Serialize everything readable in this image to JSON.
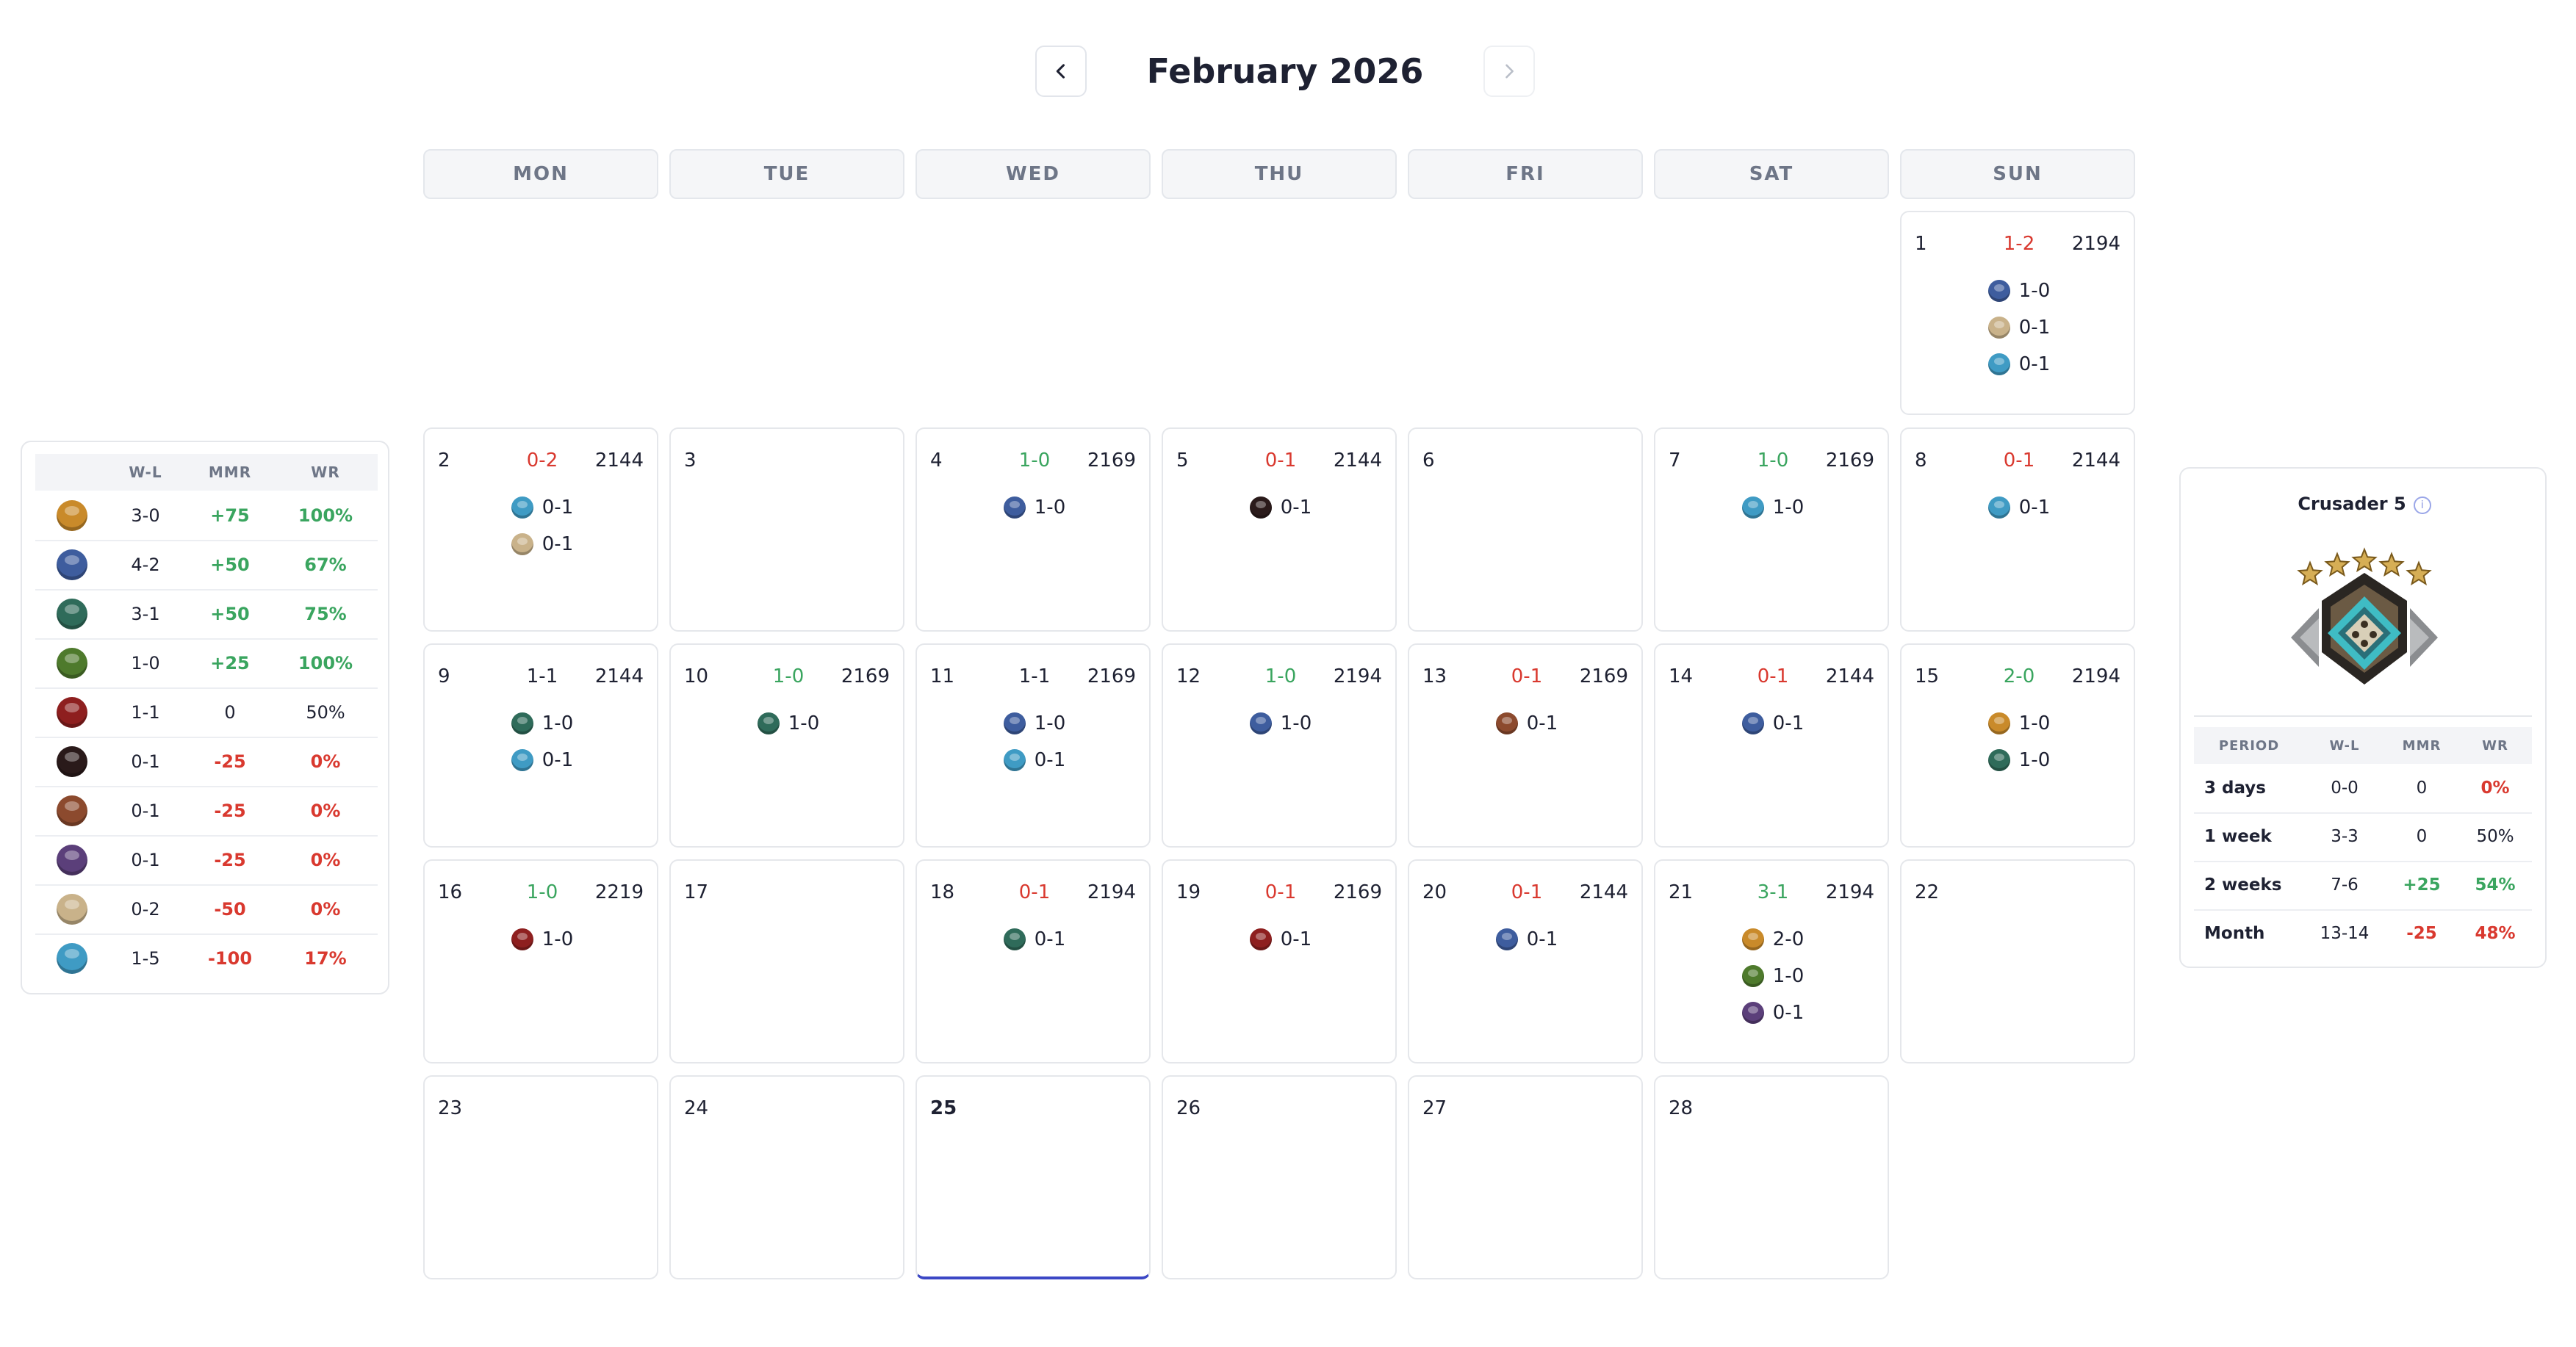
{
  "header": {
    "title": "February 2026",
    "prev_icon": "chevron-left-icon",
    "next_icon": "chevron-right-icon"
  },
  "weekdays": [
    "MON",
    "TUE",
    "WED",
    "THU",
    "FRI",
    "SAT",
    "SUN"
  ],
  "colors": {
    "positive": "#3aa55f",
    "negative": "#d9392f",
    "today_accent": "#3b47c5"
  },
  "days": [
    {
      "day": "1",
      "wl": "1-2",
      "mmr": "2194",
      "tone": "neg",
      "heroes": [
        {
          "icon": "hero-blue-mage",
          "wl": "1-0"
        },
        {
          "icon": "hero-bone-knight",
          "wl": "0-1"
        },
        {
          "icon": "hero-ice-spirit",
          "wl": "0-1"
        }
      ]
    },
    {
      "day": "2",
      "wl": "0-2",
      "mmr": "2144",
      "tone": "neg",
      "heroes": [
        {
          "icon": "hero-ice-spirit",
          "wl": "0-1"
        },
        {
          "icon": "hero-bone-knight",
          "wl": "0-1"
        }
      ]
    },
    {
      "day": "3",
      "wl": "",
      "mmr": "",
      "tone": "neu",
      "heroes": []
    },
    {
      "day": "4",
      "wl": "1-0",
      "mmr": "2169",
      "tone": "pos",
      "heroes": [
        {
          "icon": "hero-blue-mage",
          "wl": "1-0"
        }
      ]
    },
    {
      "day": "5",
      "wl": "0-1",
      "mmr": "2144",
      "tone": "neg",
      "heroes": [
        {
          "icon": "hero-shadow-demon",
          "wl": "0-1"
        }
      ]
    },
    {
      "day": "6",
      "wl": "",
      "mmr": "",
      "tone": "neu",
      "heroes": []
    },
    {
      "day": "7",
      "wl": "1-0",
      "mmr": "2169",
      "tone": "pos",
      "heroes": [
        {
          "icon": "hero-ice-spirit",
          "wl": "1-0"
        }
      ]
    },
    {
      "day": "8",
      "wl": "0-1",
      "mmr": "2144",
      "tone": "neg",
      "heroes": [
        {
          "icon": "hero-ice-spirit",
          "wl": "0-1"
        }
      ]
    },
    {
      "day": "9",
      "wl": "1-1",
      "mmr": "2144",
      "tone": "neu",
      "heroes": [
        {
          "icon": "hero-green-undead",
          "wl": "1-0"
        },
        {
          "icon": "hero-ice-spirit",
          "wl": "0-1"
        }
      ]
    },
    {
      "day": "10",
      "wl": "1-0",
      "mmr": "2169",
      "tone": "pos",
      "heroes": [
        {
          "icon": "hero-green-undead",
          "wl": "1-0"
        }
      ]
    },
    {
      "day": "11",
      "wl": "1-1",
      "mmr": "2169",
      "tone": "neu",
      "heroes": [
        {
          "icon": "hero-blue-mage",
          "wl": "1-0"
        },
        {
          "icon": "hero-ice-spirit",
          "wl": "0-1"
        }
      ]
    },
    {
      "day": "12",
      "wl": "1-0",
      "mmr": "2194",
      "tone": "pos",
      "heroes": [
        {
          "icon": "hero-blue-mage",
          "wl": "1-0"
        }
      ]
    },
    {
      "day": "13",
      "wl": "0-1",
      "mmr": "2169",
      "tone": "neg",
      "heroes": [
        {
          "icon": "hero-red-hair",
          "wl": "0-1"
        }
      ]
    },
    {
      "day": "14",
      "wl": "0-1",
      "mmr": "2144",
      "tone": "neg",
      "heroes": [
        {
          "icon": "hero-blue-mage",
          "wl": "0-1"
        }
      ]
    },
    {
      "day": "15",
      "wl": "2-0",
      "mmr": "2194",
      "tone": "pos",
      "heroes": [
        {
          "icon": "hero-golden-king",
          "wl": "1-0"
        },
        {
          "icon": "hero-green-undead",
          "wl": "1-0"
        }
      ]
    },
    {
      "day": "16",
      "wl": "1-0",
      "mmr": "2219",
      "tone": "pos",
      "heroes": [
        {
          "icon": "hero-red-beast",
          "wl": "1-0"
        }
      ]
    },
    {
      "day": "17",
      "wl": "",
      "mmr": "",
      "tone": "neu",
      "heroes": []
    },
    {
      "day": "18",
      "wl": "0-1",
      "mmr": "2194",
      "tone": "neg",
      "heroes": [
        {
          "icon": "hero-green-undead",
          "wl": "0-1"
        }
      ]
    },
    {
      "day": "19",
      "wl": "0-1",
      "mmr": "2169",
      "tone": "neg",
      "heroes": [
        {
          "icon": "hero-red-beast",
          "wl": "0-1"
        }
      ]
    },
    {
      "day": "20",
      "wl": "0-1",
      "mmr": "2144",
      "tone": "neg",
      "heroes": [
        {
          "icon": "hero-blue-mage",
          "wl": "0-1"
        }
      ]
    },
    {
      "day": "21",
      "wl": "3-1",
      "mmr": "2194",
      "tone": "pos",
      "heroes": [
        {
          "icon": "hero-golden-king",
          "wl": "2-0"
        },
        {
          "icon": "hero-orc-warrior",
          "wl": "1-0"
        },
        {
          "icon": "hero-purple-beast",
          "wl": "0-1"
        }
      ]
    },
    {
      "day": "22",
      "wl": "",
      "mmr": "",
      "tone": "neu",
      "heroes": []
    },
    {
      "day": "23",
      "wl": "",
      "mmr": "",
      "tone": "neu",
      "heroes": []
    },
    {
      "day": "24",
      "wl": "",
      "mmr": "",
      "tone": "neu",
      "heroes": []
    },
    {
      "day": "25",
      "wl": "",
      "mmr": "",
      "tone": "neu",
      "heroes": [],
      "today": true
    },
    {
      "day": "26",
      "wl": "",
      "mmr": "",
      "tone": "neu",
      "heroes": []
    },
    {
      "day": "27",
      "wl": "",
      "mmr": "",
      "tone": "neu",
      "heroes": []
    },
    {
      "day": "28",
      "wl": "",
      "mmr": "",
      "tone": "neu",
      "heroes": []
    }
  ],
  "hero_colors": {
    "hero-blue-mage": "#3e5d9e",
    "hero-bone-knight": "#c9b28a",
    "hero-ice-spirit": "#3f9bc4",
    "hero-shadow-demon": "#2a1a1a",
    "hero-green-undead": "#2f6b5a",
    "hero-red-hair": "#8c4a2e",
    "hero-golden-king": "#c98a2a",
    "hero-red-beast": "#8e1f1f",
    "hero-orc-warrior": "#4e7a2c",
    "hero-purple-beast": "#5b3f7a"
  },
  "hero_stats": {
    "headers": [
      "",
      "W-L",
      "MMR",
      "WR"
    ],
    "rows": [
      {
        "icon": "hero-golden-king",
        "wl": "3-0",
        "mmr": "+75",
        "wr": "100%",
        "tone": "pos"
      },
      {
        "icon": "hero-blue-mage",
        "wl": "4-2",
        "mmr": "+50",
        "wr": "67%",
        "tone": "pos"
      },
      {
        "icon": "hero-green-undead",
        "wl": "3-1",
        "mmr": "+50",
        "wr": "75%",
        "tone": "pos"
      },
      {
        "icon": "hero-orc-warrior",
        "wl": "1-0",
        "mmr": "+25",
        "wr": "100%",
        "tone": "pos"
      },
      {
        "icon": "hero-red-beast",
        "wl": "1-1",
        "mmr": "0",
        "wr": "50%",
        "tone": "neu"
      },
      {
        "icon": "hero-shadow-demon",
        "wl": "0-1",
        "mmr": "-25",
        "wr": "0%",
        "tone": "neg"
      },
      {
        "icon": "hero-red-hair",
        "wl": "0-1",
        "mmr": "-25",
        "wr": "0%",
        "tone": "neg"
      },
      {
        "icon": "hero-purple-beast",
        "wl": "0-1",
        "mmr": "-25",
        "wr": "0%",
        "tone": "neg"
      },
      {
        "icon": "hero-bone-knight",
        "wl": "0-2",
        "mmr": "-50",
        "wr": "0%",
        "tone": "neg"
      },
      {
        "icon": "hero-ice-spirit",
        "wl": "1-5",
        "mmr": "-100",
        "wr": "17%",
        "tone": "neg"
      }
    ]
  },
  "rank": {
    "title": "Crusader 5",
    "info_icon": "info-icon",
    "medal_icon": "crusader-medal-icon",
    "stars": 5,
    "headers": [
      "PERIOD",
      "W-L",
      "MMR",
      "WR"
    ],
    "periods": [
      {
        "period": "3 days",
        "wl": "0-0",
        "mmr": "0",
        "wr": "0%",
        "tone": "neg",
        "mmr_tone": "neu"
      },
      {
        "period": "1 week",
        "wl": "3-3",
        "mmr": "0",
        "wr": "50%",
        "tone": "neu",
        "mmr_tone": "neu"
      },
      {
        "period": "2 weeks",
        "wl": "7-6",
        "mmr": "+25",
        "wr": "54%",
        "tone": "pos",
        "mmr_tone": "pos"
      },
      {
        "period": "Month",
        "wl": "13-14",
        "mmr": "-25",
        "wr": "48%",
        "tone": "neg",
        "mmr_tone": "neg"
      }
    ]
  }
}
